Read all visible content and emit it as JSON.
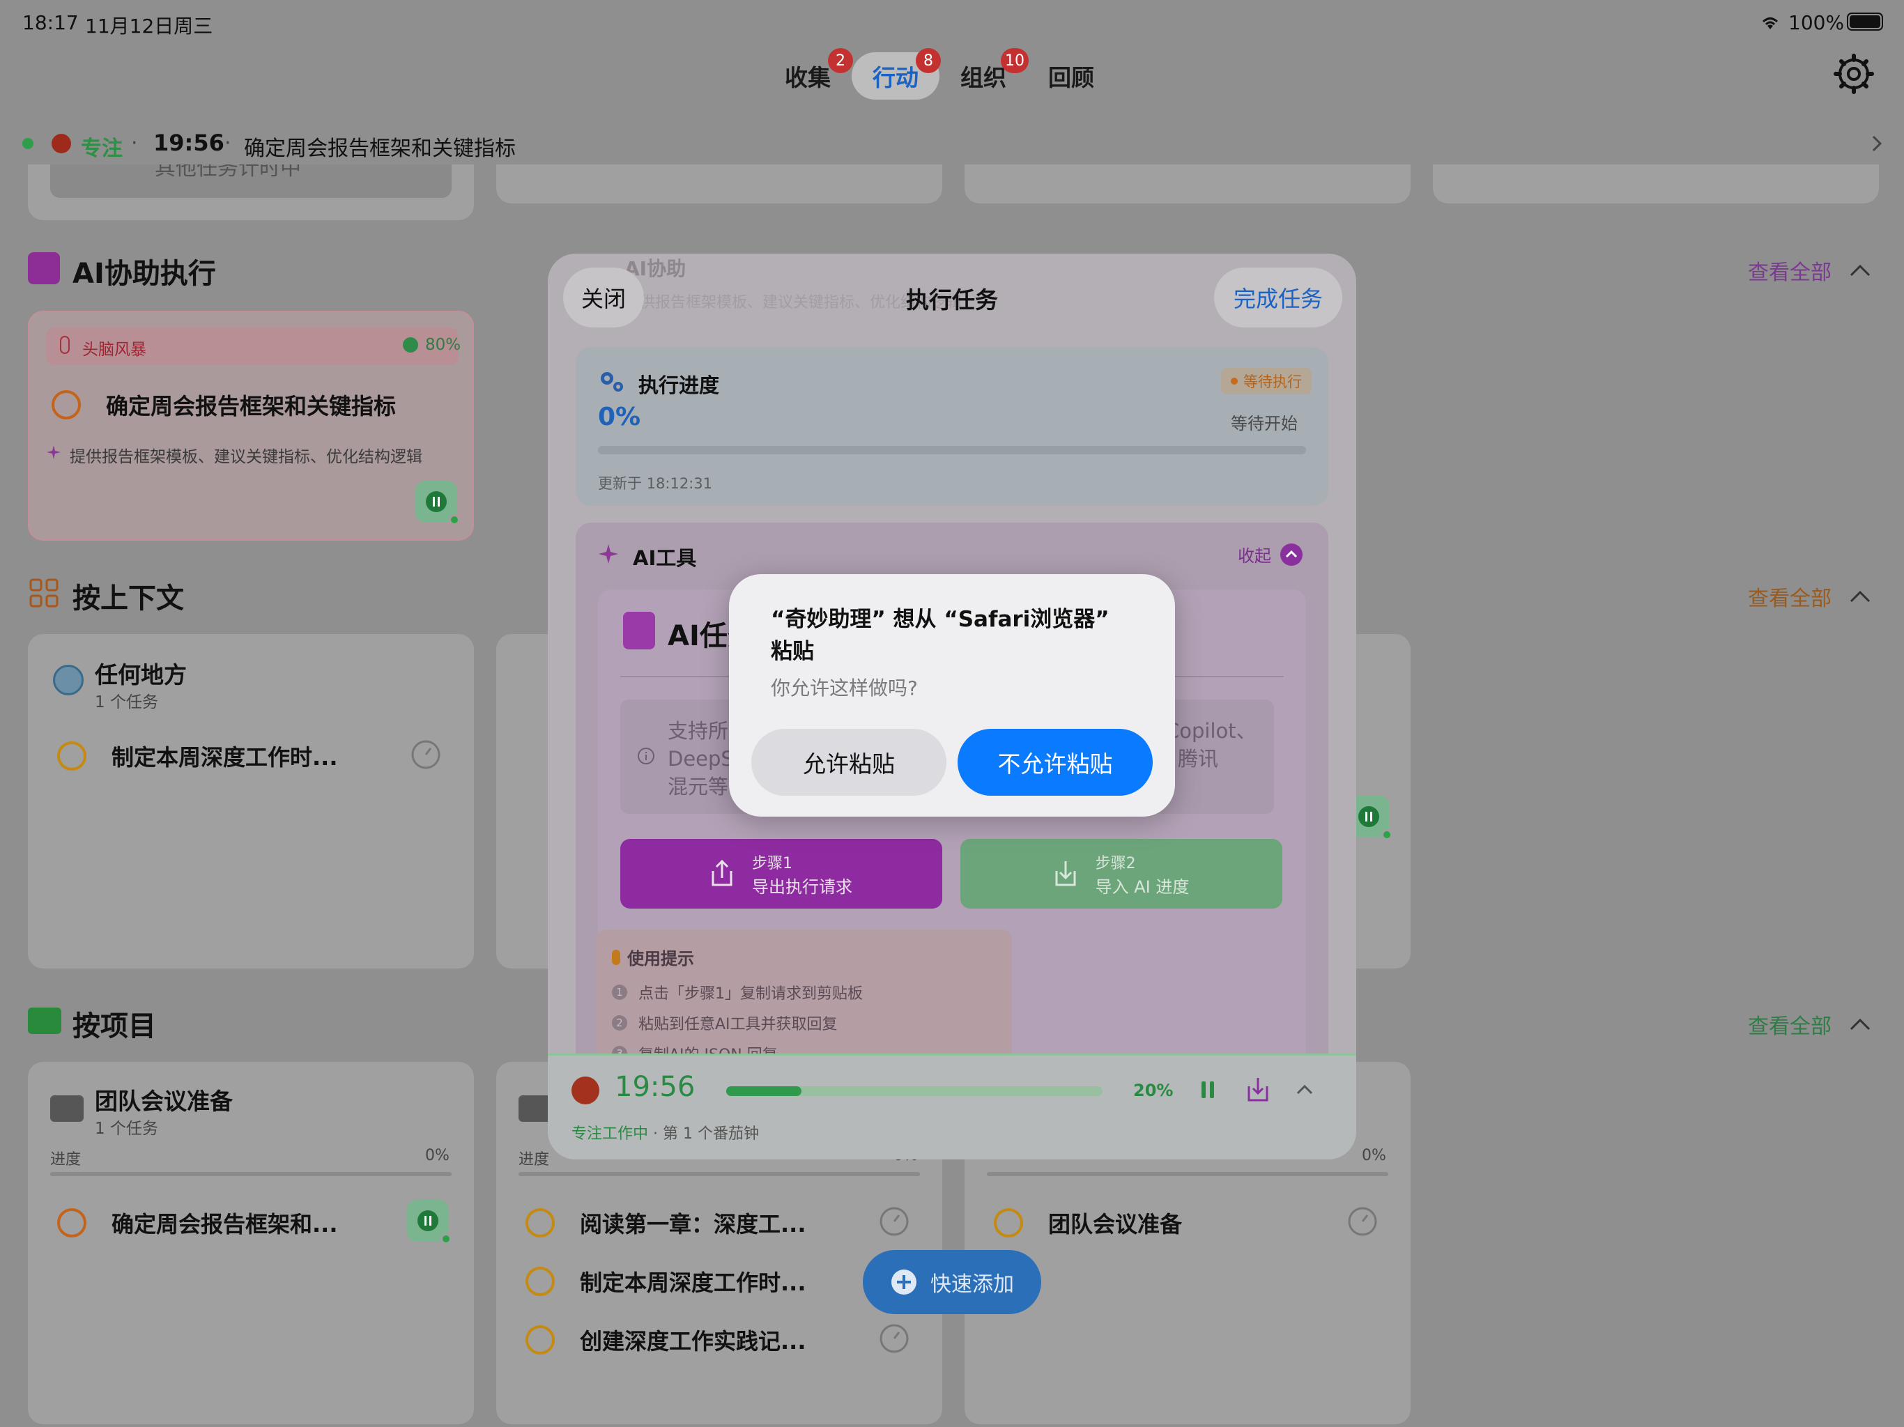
{
  "status_bar": {
    "time": "18:17",
    "date": "11月12日周三",
    "battery": "100%"
  },
  "tabs": [
    {
      "label": "收集",
      "badge": "2"
    },
    {
      "label": "行动",
      "badge": "8"
    },
    {
      "label": "组织",
      "badge": "10"
    },
    {
      "label": "回顾",
      "badge": ""
    }
  ],
  "focus_bar": {
    "label": "专注",
    "time": "19:56",
    "task": "确定周会报告框架和关键指标"
  },
  "background": {
    "top_row_partial": "其他任务计时中",
    "ai_section": {
      "title": "AI协助执行",
      "see_all": "查看全部",
      "card": {
        "tag": "头脑风暴",
        "score": "80%",
        "task": "确定周会报告框架和关键指标",
        "hint": "提供报告框架模板、建议关键指标、优化结构逻辑"
      }
    },
    "context_section": {
      "title": "按上下文",
      "see_all": "查看全部",
      "card": {
        "name": "任何地方",
        "count": "1 个任务",
        "task": "制定本周深度工作时..."
      }
    },
    "project_section": {
      "title": "按项目",
      "see_all": "查看全部",
      "cards": [
        {
          "name": "团队会议准备",
          "count": "1 个任务",
          "progress_label": "进度",
          "progress": "0%",
          "tasks": [
            "确定周会报告框架和..."
          ]
        },
        {
          "name": "",
          "count": "",
          "progress_label": "进度",
          "progress": "0%",
          "tasks": [
            "阅读第一章：深度工...",
            "制定本周深度工作时...",
            "创建深度工作实践记..."
          ]
        },
        {
          "name": "",
          "count": "",
          "progress_label": "进度",
          "progress": "0%",
          "tasks": [
            "团队会议准备"
          ]
        }
      ]
    }
  },
  "sheet": {
    "close": "关闭",
    "title": "执行任务",
    "complete": "完成任务",
    "behind_header_title": "AI协助",
    "behind_header_sub": "提供报告框架模板、建议关键指标、优化结构逻辑",
    "progress": {
      "title": "执行进度",
      "status": "等待执行",
      "percent": "0%",
      "state": "等待开始",
      "updated": "更新于 18:12:31"
    },
    "ai_tools": {
      "title": "AI工具",
      "collapse": "收起",
      "inner_title": "AI任务",
      "info_text_left": "支持所有AI工具",
      "info_text_left2": "DeepSeek、",
      "info_text_left3": "混元等",
      "info_text_right": "Copilot、",
      "info_text_right2": "腾讯",
      "step1": {
        "label": "步骤1",
        "action": "导出执行请求"
      },
      "step2": {
        "label": "步骤2",
        "action": "导入 AI 进度"
      },
      "tips_title": "使用提示",
      "tips": [
        "点击「步骤1」复制请求到剪贴板",
        "粘贴到任意AI工具并获取回复",
        "复制AI的 JSON 回复"
      ]
    },
    "timer": {
      "time": "19:56",
      "percent": "20%",
      "progress": 0.2,
      "status": "专注工作中",
      "session": "第 1 个番茄钟"
    }
  },
  "alert": {
    "title": "“奇妙助理” 想从 “Safari浏览器” 粘贴",
    "message": "你允许这样做吗?",
    "allow": "允许粘贴",
    "deny": "不允许粘贴"
  },
  "fab": {
    "label": "快速添加"
  },
  "colors": {
    "accent_blue": "#0a7aff",
    "purple": "#a33ac2",
    "green": "#34b356",
    "orange": "#e0701c"
  }
}
